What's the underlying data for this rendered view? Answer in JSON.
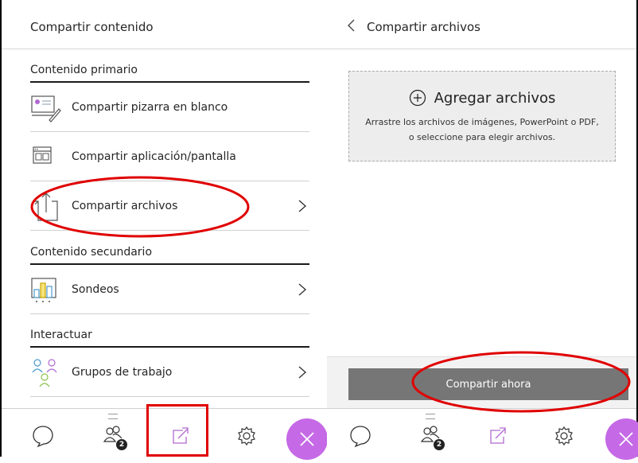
{
  "left_panel": {
    "title": "Compartir contenido",
    "sections": {
      "primary": "Contenido primario",
      "secondary": "Contenido secundario",
      "interact": "Interactuar"
    },
    "items": {
      "whiteboard": "Compartir pizarra en blanco",
      "app_screen": "Compartir aplicación/pantalla",
      "files": "Compartir archivos",
      "polls": "Sondeos",
      "groups": "Grupos de trabajo"
    }
  },
  "right_panel": {
    "title": "Compartir archivos",
    "add_files": "Agregar archivos",
    "drop_desc": "Arrastre los archivos de imágenes, PowerPoint o PDF, o seleccione para elegir archivos.",
    "share_now": "Compartir ahora"
  },
  "bottom_bar": {
    "participants_badge": "2"
  },
  "colors": {
    "accent_purple": "#c569e6",
    "annotation_red": "#e00000",
    "button_gray": "#767676"
  }
}
